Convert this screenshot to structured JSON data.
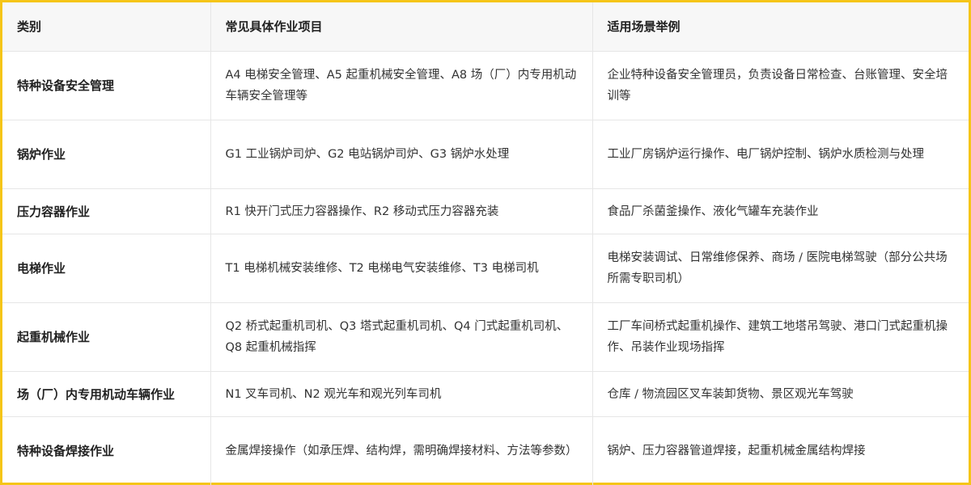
{
  "table": {
    "headers": [
      "类别",
      "常见具体作业项目",
      "适用场景举例"
    ],
    "rows": [
      {
        "category": "特种设备安全管理",
        "items": "A4 电梯安全管理、A5 起重机械安全管理、A8 场（厂）内专用机动车辆安全管理等",
        "scenes": "企业特种设备安全管理员，负责设备日常检查、台账管理、安全培训等"
      },
      {
        "category": "锅炉作业",
        "items": "G1 工业锅炉司炉、G2 电站锅炉司炉、G3 锅炉水处理",
        "scenes": "工业厂房锅炉运行操作、电厂锅炉控制、锅炉水质检测与处理"
      },
      {
        "category": "压力容器作业",
        "items": "R1 快开门式压力容器操作、R2 移动式压力容器充装",
        "scenes": "食品厂杀菌釜操作、液化气罐车充装作业"
      },
      {
        "category": "电梯作业",
        "items": "T1 电梯机械安装维修、T2 电梯电气安装维修、T3 电梯司机",
        "scenes": "电梯安装调试、日常维修保养、商场 / 医院电梯驾驶（部分公共场所需专职司机）"
      },
      {
        "category": "起重机械作业",
        "items": "Q2 桥式起重机司机、Q3 塔式起重机司机、Q4 门式起重机司机、Q8 起重机械指挥",
        "scenes": "工厂车间桥式起重机操作、建筑工地塔吊驾驶、港口门式起重机操作、吊装作业现场指挥"
      },
      {
        "category": "场（厂）内专用机动车辆作业",
        "items": "N1 叉车司机、N2 观光车和观光列车司机",
        "scenes": "仓库 / 物流园区叉车装卸货物、景区观光车驾驶"
      },
      {
        "category": "特种设备焊接作业",
        "items": "金属焊接操作（如承压焊、结构焊，需明确焊接材料、方法等参数）",
        "scenes": "锅炉、压力容器管道焊接，起重机械金属结构焊接"
      }
    ]
  },
  "colors": {
    "frame_border": "#f5c518",
    "header_bg": "#f7f7f7",
    "grid_line": "#e6e6e6",
    "text": "#333333"
  }
}
